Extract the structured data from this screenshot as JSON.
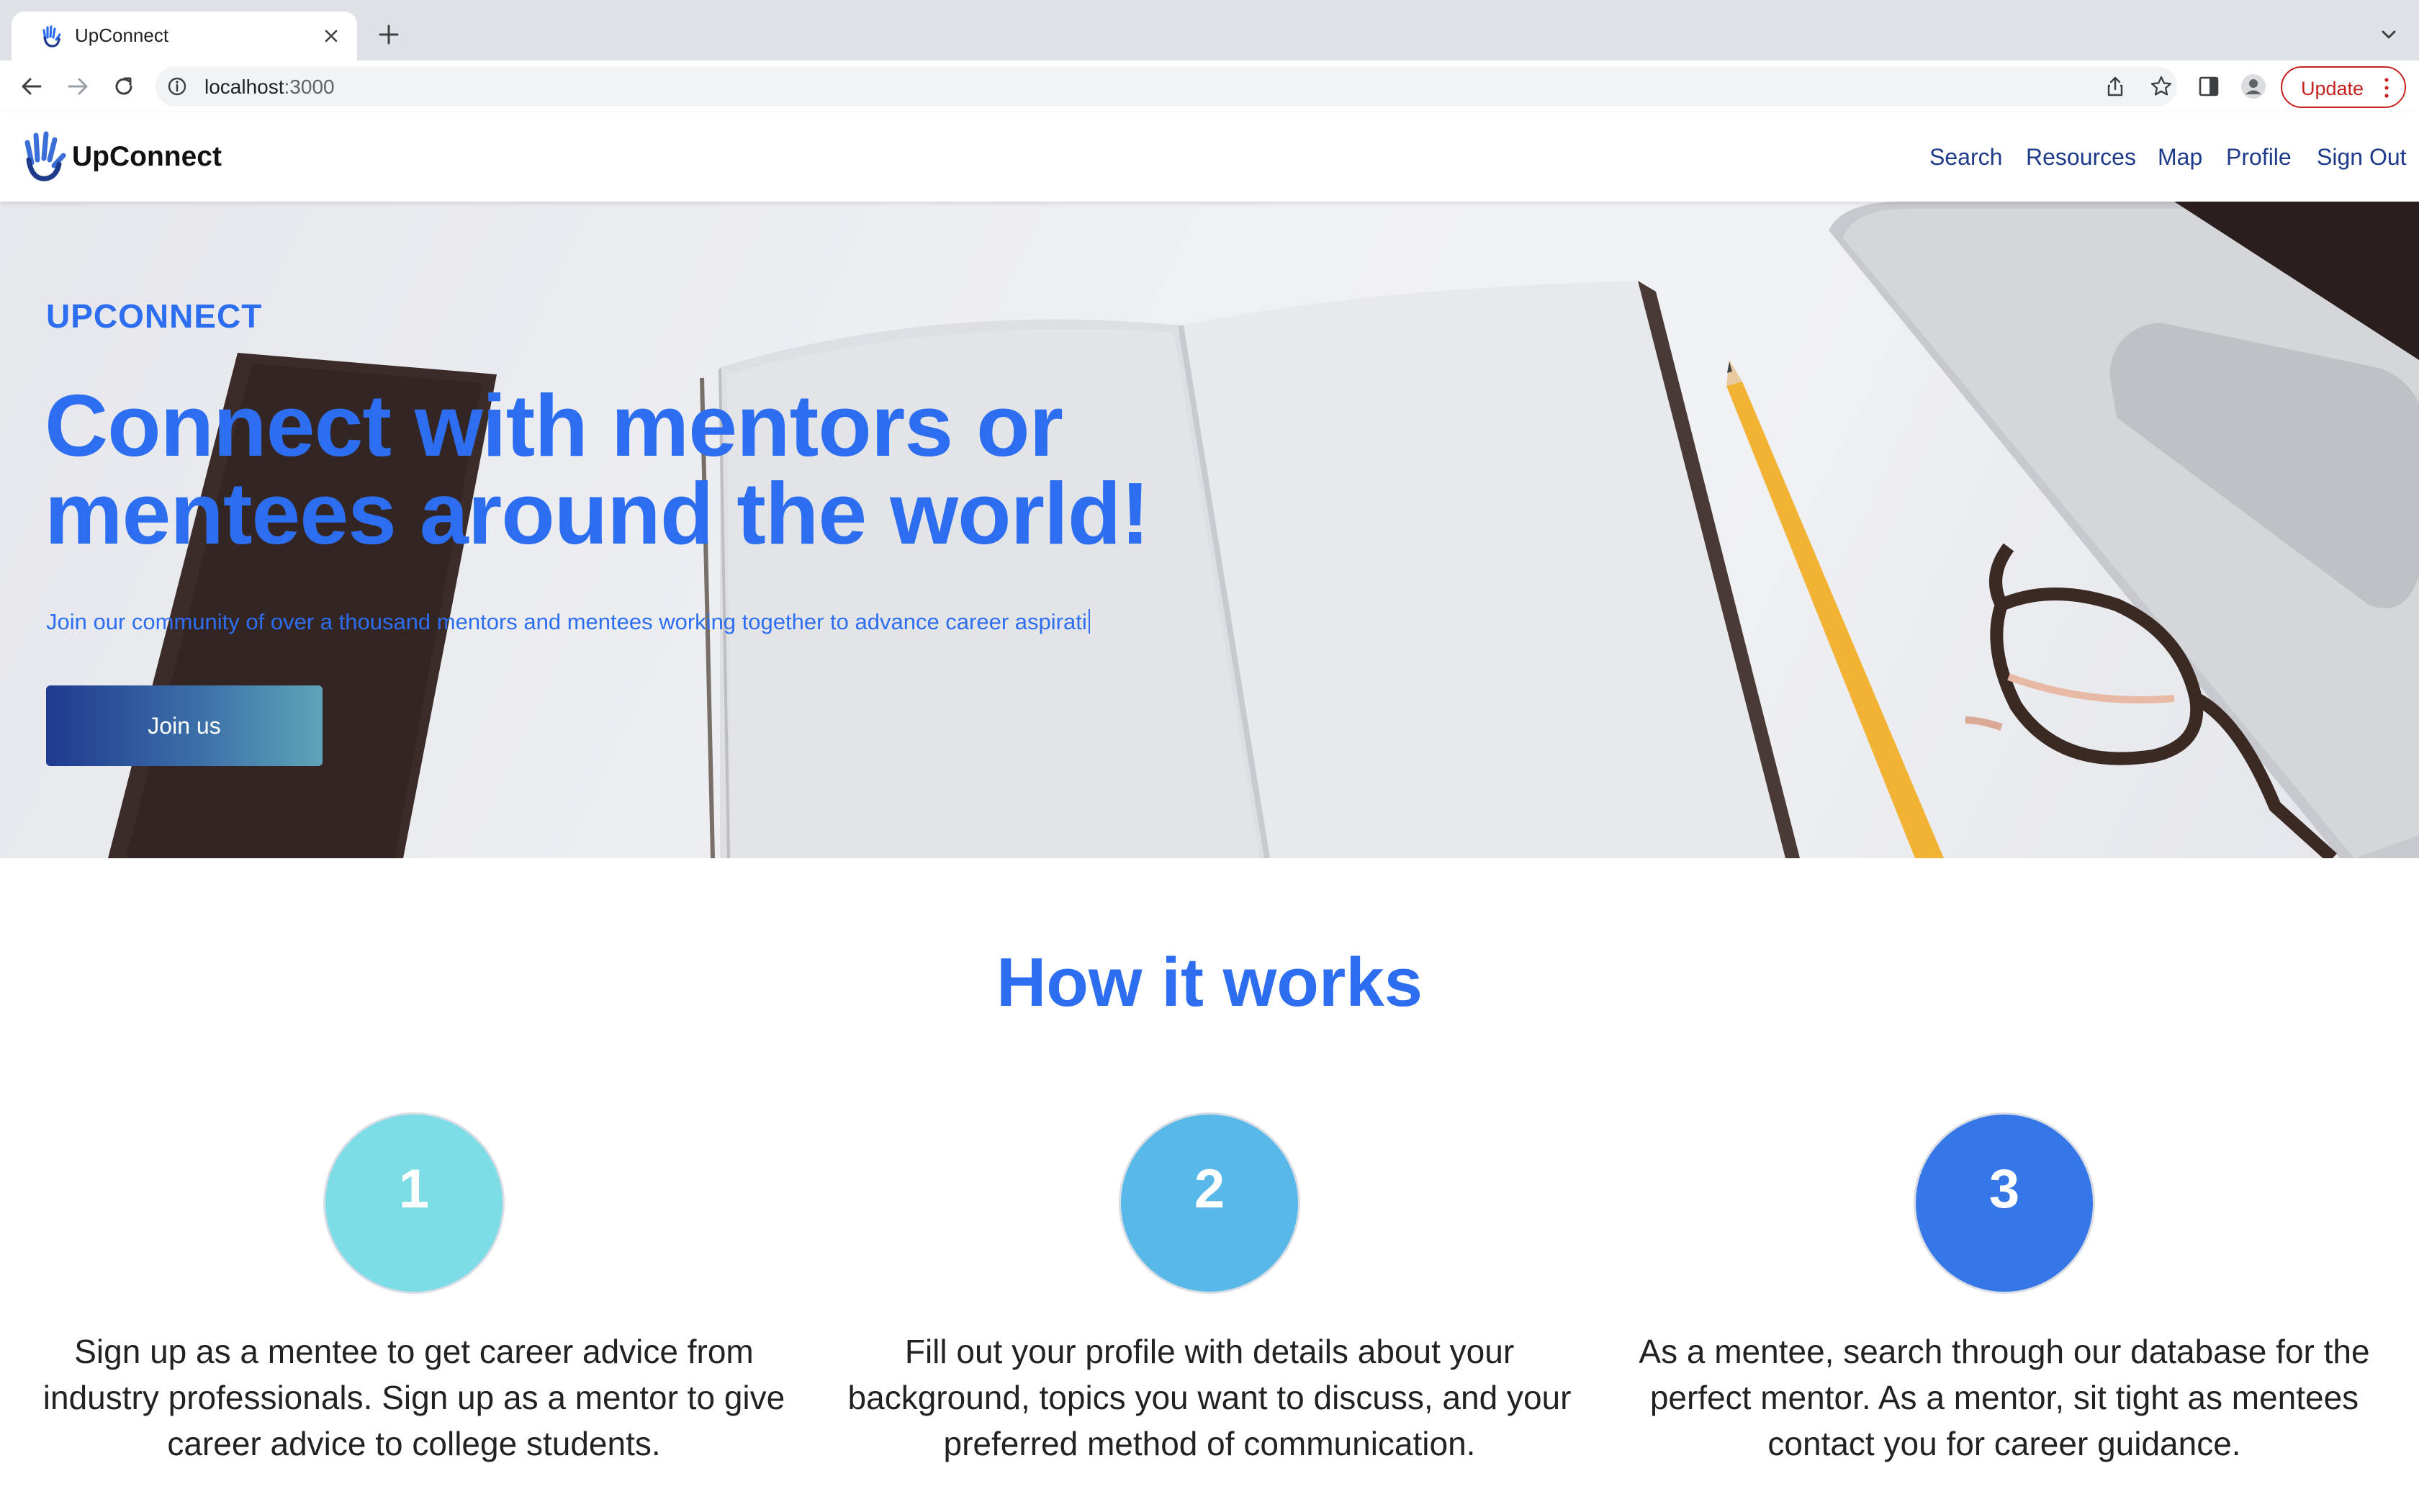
{
  "browser": {
    "tab_title": "UpConnect",
    "url_host": "localhost",
    "url_port": ":3000",
    "update_label": "Update",
    "icons": [
      "hand-favicon-icon",
      "close-icon",
      "plus-icon",
      "chevron-down-icon",
      "back-arrow-icon",
      "forward-arrow-icon",
      "reload-icon",
      "info-icon",
      "share-icon",
      "star-icon",
      "side-panel-icon",
      "profile-avatar-icon",
      "more-vertical-icon"
    ]
  },
  "navbar": {
    "brand": "UpConnect",
    "links": [
      "Search",
      "Resources",
      "Map",
      "Profile",
      "Sign Out"
    ]
  },
  "hero": {
    "eyebrow": "UPCONNECT",
    "title": "Connect with mentors or mentees around the world!",
    "subtitle": "Join our community of over a thousand mentors and mentees working together to advance career aspirati",
    "cta_label": "Join us"
  },
  "how": {
    "title": "How it works",
    "steps": [
      {
        "number": "1",
        "color": "#7ddde6",
        "text": "Sign up as a mentee to get career advice from industry professionals. Sign up as a mentor to give career advice to college students."
      },
      {
        "number": "2",
        "color": "#58b9e9",
        "text": "Fill out your profile with details about your background, topics you want to discuss, and your preferred method of communication."
      },
      {
        "number": "3",
        "color": "#3577e6",
        "text": "As a mentee, search through our database for the perfect mentor. As a mentor, sit tight as mentees contact you for career guidance."
      }
    ]
  },
  "colors": {
    "accent": "#2d6ef0",
    "nav_link": "#1e3a8a",
    "update_red": "#c5221f"
  }
}
